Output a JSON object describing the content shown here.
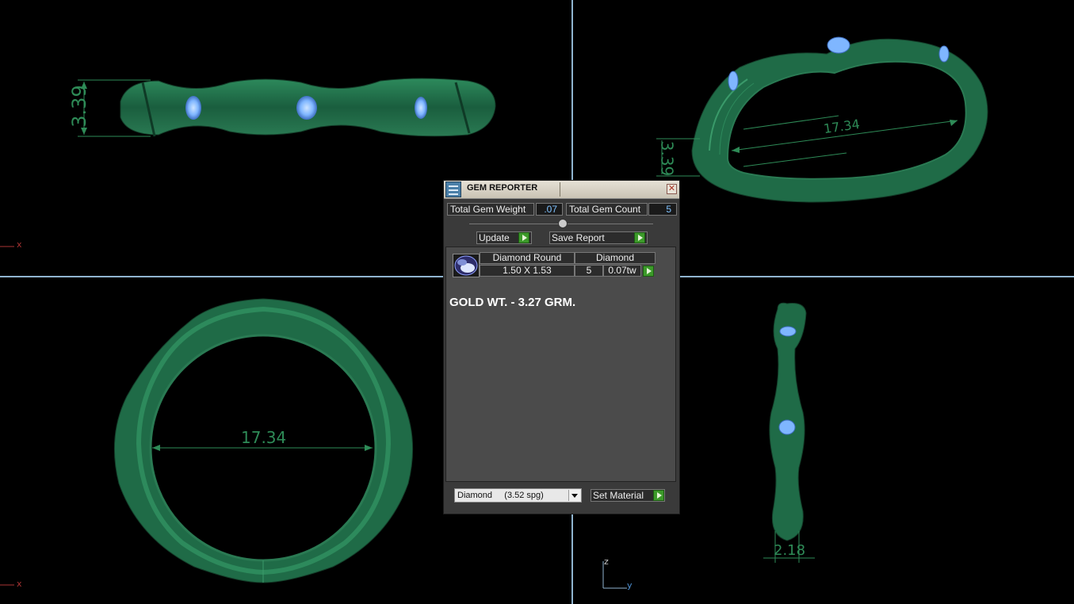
{
  "dimensions": {
    "front_height": "3.39",
    "iso_width": "17.34",
    "iso_height": "3.39",
    "top_inner_diameter": "17.34",
    "side_width": "2.18"
  },
  "axes": {
    "front_x": "x",
    "top_x": "x",
    "side_z": "z",
    "side_y": "y"
  },
  "dialog": {
    "title": "GEM REPORTER",
    "total_gem_weight_label": "Total Gem Weight",
    "total_gem_weight_value": ".07",
    "total_gem_count_label": "Total Gem Count",
    "total_gem_count_value": "5",
    "update_label": "Update",
    "save_report_label": "Save Report",
    "gem": {
      "name": "Diamond Round",
      "material": "Diamond",
      "size": "1.50 X 1.53",
      "count": "5",
      "weight": "0.07tw"
    },
    "gold_weight_text": "GOLD WT. - 3.27 GRM.",
    "material_select": "Diamond     (3.52 spg)",
    "set_material_label": "Set Material"
  },
  "colors": {
    "ring_green": "#1f6b47",
    "dimension_green": "#2e8b57",
    "gem_blue": "#7fb6ff",
    "viewport_divider": "#8fb4cf"
  }
}
